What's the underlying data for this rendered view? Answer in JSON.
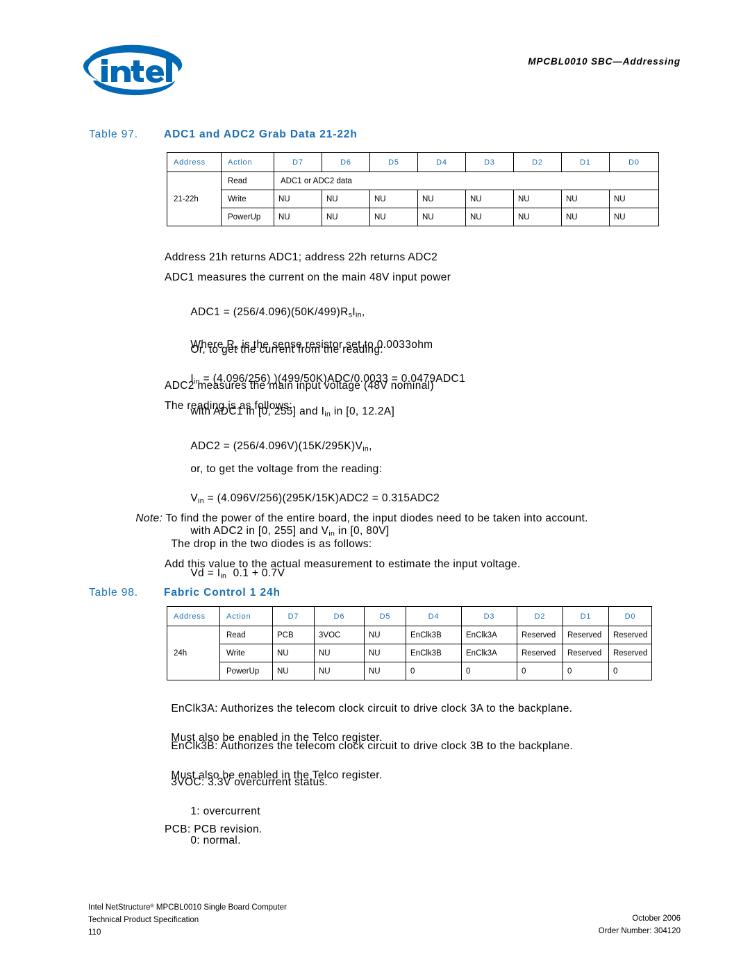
{
  "header": {
    "logo_alt": "intel",
    "doc_title": "MPCBL0010 SBC—Addressing"
  },
  "table97": {
    "caption_number": "Table 97.",
    "caption_title": "ADC1 and ADC2 Grab Data 21-22h",
    "columns": [
      "Address",
      "Action",
      "D7",
      "D6",
      "D5",
      "D4",
      "D3",
      "D2",
      "D1",
      "D0"
    ],
    "address": "21-22h",
    "rows": [
      {
        "action": "Read",
        "span_value": "ADC1 or ADC2 data"
      },
      {
        "action": "Write",
        "cells": [
          "NU",
          "NU",
          "NU",
          "NU",
          "NU",
          "NU",
          "NU",
          "NU"
        ]
      },
      {
        "action": "PowerUp",
        "cells": [
          "NU",
          "NU",
          "NU",
          "NU",
          "NU",
          "NU",
          "NU",
          "NU"
        ]
      }
    ]
  },
  "table98": {
    "caption_number": "Table 98.",
    "caption_title": "Fabric Control 1 24h",
    "columns": [
      "Address",
      "Action",
      "D7",
      "D6",
      "D5",
      "D4",
      "D3",
      "D2",
      "D1",
      "D0"
    ],
    "address": "24h",
    "rows": [
      {
        "action": "Read",
        "cells": [
          "PCB",
          "3VOC",
          "NU",
          "EnClk3B",
          "EnClk3A",
          "Reserved",
          "Reserved",
          "Reserved"
        ]
      },
      {
        "action": "Write",
        "cells": [
          "NU",
          "NU",
          "NU",
          "EnClk3B",
          "EnClk3A",
          "Reserved",
          "Reserved",
          "Reserved"
        ]
      },
      {
        "action": "PowerUp",
        "cells": [
          "NU",
          "NU",
          "NU",
          "0",
          "0",
          "0",
          "0",
          "0"
        ]
      }
    ]
  },
  "body": {
    "p_address_returns": "Address 21h returns ADC1; address 22h returns ADC2",
    "p_adc1_measures": "ADC1 measures the current on the main 48V input power",
    "eq_adc1_line1_a": "ADC1 = (256/4.096)(50K/499)R",
    "eq_adc1_line1_sub1": "s",
    "eq_adc1_line1_b": "I",
    "eq_adc1_line1_sub2": "in",
    "eq_adc1_line1_c": ",",
    "eq_adc1_line2_a": "Where R",
    "eq_adc1_line2_sub": "s",
    "eq_adc1_line2_b": " is the sense resistor set to 0.0033ohm",
    "p_or_current": "Or, to get the current from the reading:",
    "eq_iin_a": "I",
    "eq_iin_sub1": "in",
    "eq_iin_b": " = (4.096/256) )(499/50K)ADC/0.0033 = 0.0479ADC1",
    "eq_iin_line2_a": "with ADC1 in [0, 255] and I",
    "eq_iin_line2_sub": "in",
    "eq_iin_line2_b": " in [0, 12.2A]",
    "p_adc2_measures": "ADC2 measures the main input voltage (48V nominal)",
    "p_reading_follows": "The reading is as follows:",
    "eq_adc2_a": "ADC2 = (256/4.096V)(15K/295K)V",
    "eq_adc2_sub": "in",
    "eq_adc2_b": ",",
    "p_or_voltage": "or, to get the voltage from the reading:",
    "eq_vin_a": "V",
    "eq_vin_sub1": "in",
    "eq_vin_b": " = (4.096V/256)(295K/15K)ADC2 = 0.315ADC2",
    "eq_vin_line2_a": "with ADC2 in [0, 255] and V",
    "eq_vin_line2_sub": "in",
    "eq_vin_line2_b": " in [0, 80V]",
    "note_label": "Note:",
    "note_text": " To find the power of the entire board, the input diodes need to be taken into account.",
    "p_drop_diodes": "The drop in the two diodes is as follows:",
    "eq_vd_a": "Vd = I",
    "eq_vd_sub": "in",
    "eq_vd_b": "  0.1 + 0.7V",
    "p_add_value": "Add this value to the actual measurement to estimate the input voltage.",
    "p_enclk3a_line1": "EnClk3A: Authorizes the telecom clock circuit to drive clock 3A to the backplane.",
    "p_enclk3a_line2": "Must also be enabled in the Telco register.",
    "p_enclk3b_line1": "EnClk3B: Authorizes the telecom clock circuit to drive clock 3B to the backplane.",
    "p_enclk3b_line2": "Must also be enabled in the Telco register.",
    "p_3voc_line1": "3VOC: 3.3V overcurrent status.",
    "p_3voc_line2": "1: overcurrent",
    "p_3voc_line3": "0: normal.",
    "p_pcb": "PCB: PCB revision."
  },
  "footer": {
    "line1_a": "Intel NetStructure",
    "line1_sup": "®",
    "line1_b": " MPCBL0010 Single Board Computer",
    "line2": "Technical Product Specification",
    "page_number": "110",
    "date": "October 2006",
    "order_number": "Order Number: 304120"
  },
  "colors": {
    "intel_blue": "#0068b5",
    "caption_blue": "#1a6fb5",
    "text_black": "#000000"
  }
}
